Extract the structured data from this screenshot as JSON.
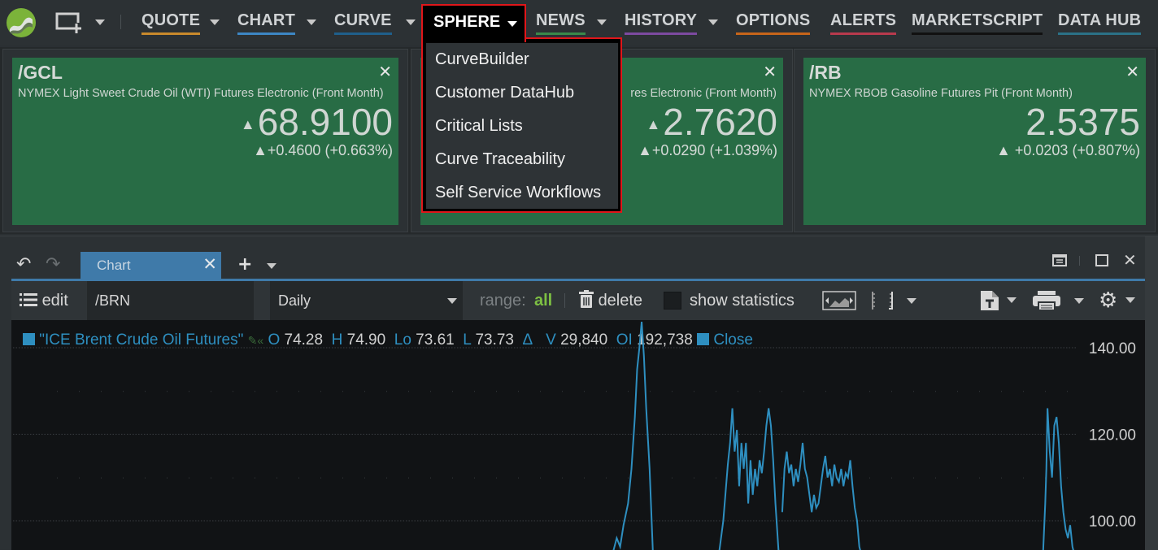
{
  "topbar": {
    "logo_icon": "app-logo",
    "new_window_icon": "new-window-icon",
    "nav": [
      {
        "label": "QUOTE",
        "underline": "#c98a2c",
        "has_menu": true
      },
      {
        "label": "CHART",
        "underline": "#3d87c4",
        "has_menu": true
      },
      {
        "label": "CURVE",
        "underline": "#1f5f8b",
        "has_menu": true
      },
      {
        "label": "SPHERE",
        "underline": "",
        "has_menu": true,
        "active": true
      },
      {
        "label": "NEWS",
        "underline": "#3a8a4a",
        "has_menu": true
      },
      {
        "label": "HISTORY",
        "underline": "#7d4aa0",
        "has_menu": true
      },
      {
        "label": "OPTIONS",
        "underline": "#c7651a",
        "has_menu": false
      },
      {
        "label": "ALERTS",
        "underline": "#b83a4d",
        "has_menu": false
      },
      {
        "label": "MARKETSCRIPT",
        "underline": "#111111",
        "has_menu": false
      },
      {
        "label": "DATA HUB",
        "underline": "#2b7187",
        "has_menu": false
      }
    ]
  },
  "sphere_menu": {
    "items": [
      "CurveBuilder",
      "Customer DataHub",
      "Critical Lists",
      "Curve Traceability",
      "Self Service Workflows"
    ]
  },
  "cards": [
    {
      "symbol": "/GCL",
      "description": "NYMEX Light Sweet Crude Oil (WTI) Futures Electronic (Front Month)",
      "price": "68.9100",
      "price_arrow": "▲",
      "change": "▲+0.4600 (+0.663%)"
    },
    {
      "symbol": "",
      "description": "res Electronic (Front Month)",
      "price": "2.7620",
      "price_arrow": "▲",
      "change": "▲+0.0290 (+1.039%)"
    },
    {
      "symbol": "/RB",
      "description": "NYMEX RBOB Gasoline Futures Pit (Front Month)",
      "price": "2.5375",
      "price_arrow": "",
      "change": "▲ +0.0203 (+0.807%)"
    }
  ],
  "card_close": "✕",
  "panel": {
    "tab_label": "Chart",
    "toolbar": {
      "edit_label": "edit",
      "symbol_value": "/BRN",
      "period_value": "Daily",
      "range_label": "range:",
      "range_value": "all",
      "delete_label": "delete",
      "show_statistics_label": "show statistics",
      "show_statistics_checked": false
    },
    "legend": {
      "series_name": "\"ICE Brent Crude Oil Futures\"",
      "O_label": "O",
      "O": "74.28",
      "H_label": "H",
      "H": "74.90",
      "Lo_label": "Lo",
      "Lo": "73.61",
      "L_label": "L",
      "L": "73.73",
      "delta_label": "Δ",
      "V_label": "V",
      "V": "29,840",
      "OI_label": "OI",
      "OI": "192,738",
      "close_label": "Close"
    }
  },
  "colors": {
    "accent": "#3f7aa9",
    "series": "#2e8fc0",
    "card_bg": "#286c45",
    "highlight": "#e0161a",
    "range_green": "#7dc043"
  },
  "chart_data": {
    "type": "line",
    "series": [
      {
        "name": "ICE Brent Crude Oil Futures — Close",
        "color": "#2e8fc0"
      }
    ],
    "y_ticks": [
      "140.00",
      "120.00",
      "100.00"
    ],
    "y_tick_values": [
      140,
      120,
      100
    ],
    "ylim": [
      92,
      146
    ],
    "visible_points": [
      [
        0.53,
        92
      ],
      [
        0.534,
        96
      ],
      [
        0.537,
        94
      ],
      [
        0.54,
        99
      ],
      [
        0.544,
        104
      ],
      [
        0.547,
        112
      ],
      [
        0.55,
        124
      ],
      [
        0.552,
        135
      ],
      [
        0.554,
        140
      ],
      [
        0.556,
        146
      ],
      [
        0.558,
        138
      ],
      [
        0.56,
        126
      ],
      [
        0.563,
        112
      ],
      [
        0.566,
        92
      ],
      [
        0.624,
        92
      ],
      [
        0.628,
        100
      ],
      [
        0.632,
        113
      ],
      [
        0.634,
        118
      ],
      [
        0.636,
        126
      ],
      [
        0.638,
        116
      ],
      [
        0.64,
        121
      ],
      [
        0.642,
        108
      ],
      [
        0.644,
        118
      ],
      [
        0.646,
        112
      ],
      [
        0.648,
        118
      ],
      [
        0.65,
        104
      ],
      [
        0.652,
        114
      ],
      [
        0.654,
        106
      ],
      [
        0.656,
        112
      ],
      [
        0.658,
        108
      ],
      [
        0.66,
        114
      ],
      [
        0.662,
        111
      ],
      [
        0.664,
        116
      ],
      [
        0.666,
        122
      ],
      [
        0.668,
        126
      ],
      [
        0.67,
        122
      ],
      [
        0.672,
        114
      ],
      [
        0.674,
        104
      ],
      [
        0.677,
        92
      ],
      [
        0.68,
        102
      ],
      [
        0.682,
        112
      ],
      [
        0.684,
        116
      ],
      [
        0.686,
        111
      ],
      [
        0.688,
        113
      ],
      [
        0.69,
        108
      ],
      [
        0.692,
        112
      ],
      [
        0.694,
        109
      ],
      [
        0.696,
        113
      ],
      [
        0.698,
        118
      ],
      [
        0.7,
        112
      ],
      [
        0.702,
        110
      ],
      [
        0.704,
        106
      ],
      [
        0.706,
        102
      ],
      [
        0.708,
        106
      ],
      [
        0.71,
        103
      ],
      [
        0.712,
        104
      ],
      [
        0.714,
        108
      ],
      [
        0.716,
        112
      ],
      [
        0.718,
        115
      ],
      [
        0.72,
        110
      ],
      [
        0.722,
        112
      ],
      [
        0.724,
        108
      ],
      [
        0.726,
        113
      ],
      [
        0.728,
        110
      ],
      [
        0.73,
        109
      ],
      [
        0.732,
        112
      ],
      [
        0.734,
        108
      ],
      [
        0.736,
        111
      ],
      [
        0.738,
        110
      ],
      [
        0.74,
        114
      ],
      [
        0.742,
        108
      ],
      [
        0.744,
        103
      ],
      [
        0.746,
        100
      ],
      [
        0.748,
        94
      ],
      [
        0.75,
        92
      ],
      [
        0.91,
        92
      ],
      [
        0.912,
        104
      ],
      [
        0.913,
        112
      ],
      [
        0.914,
        126
      ],
      [
        0.916,
        116
      ],
      [
        0.918,
        110
      ],
      [
        0.92,
        122
      ],
      [
        0.922,
        124
      ],
      [
        0.924,
        118
      ],
      [
        0.926,
        108
      ],
      [
        0.928,
        102
      ],
      [
        0.93,
        98
      ],
      [
        0.932,
        96
      ],
      [
        0.934,
        99
      ],
      [
        0.936,
        94
      ],
      [
        0.938,
        92
      ]
    ],
    "grid": true,
    "legend": "top-left"
  }
}
